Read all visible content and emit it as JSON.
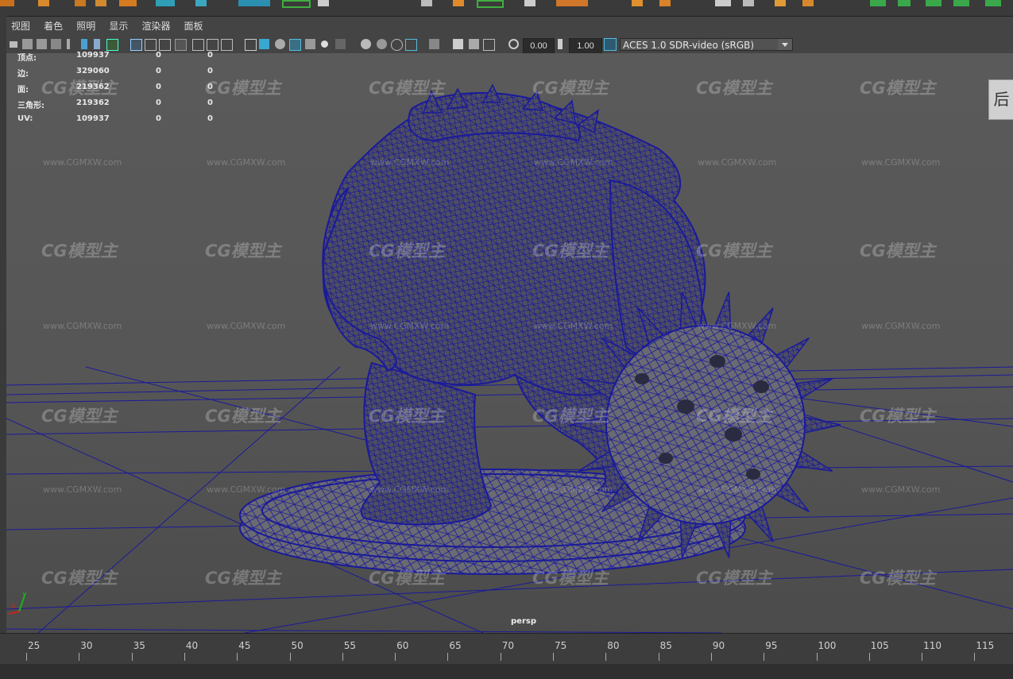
{
  "menu": {
    "items": [
      "视图",
      "着色",
      "照明",
      "显示",
      "渲染器",
      "面板"
    ]
  },
  "toolbar": {
    "exposure_value": "0.00",
    "gamma_value": "1.00",
    "color_space": "ACES 1.0 SDR-video (sRGB)"
  },
  "stats": [
    {
      "label": "顶点:",
      "v1": "109937",
      "v2": "0",
      "v3": "0"
    },
    {
      "label": "边:",
      "v1": "329060",
      "v2": "0",
      "v3": "0"
    },
    {
      "label": "面:",
      "v1": "219362",
      "v2": "0",
      "v3": "0"
    },
    {
      "label": "三角形:",
      "v1": "219362",
      "v2": "0",
      "v3": "0"
    },
    {
      "label": "UV:",
      "v1": "109937",
      "v2": "0",
      "v3": "0"
    }
  ],
  "viewport": {
    "camera_label": "persp",
    "side_button": "后",
    "wireframe_color": "#1a1a9a"
  },
  "watermark": {
    "logo": "CG模型主",
    "url": "www.CGMXW.com"
  },
  "timeline": {
    "frames": [
      "25",
      "30",
      "35",
      "40",
      "45",
      "50",
      "55",
      "60",
      "65",
      "70",
      "75",
      "80",
      "85",
      "90",
      "95",
      "100",
      "105",
      "110",
      "115"
    ]
  }
}
